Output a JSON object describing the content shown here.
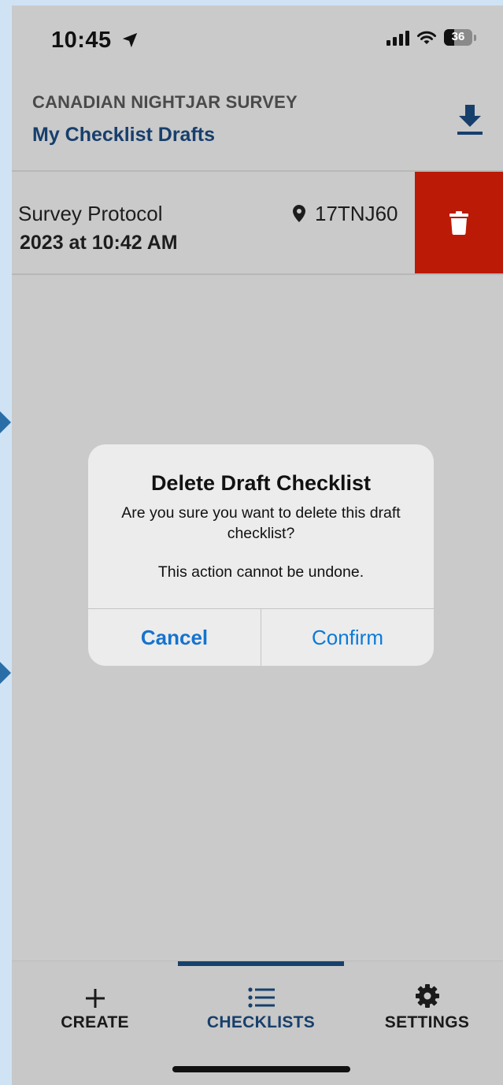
{
  "status_bar": {
    "time": "10:45",
    "battery": "36",
    "battery_level": 0.36
  },
  "header": {
    "app_title": "CANADIAN NIGHTJAR SURVEY",
    "page_title": "My Checklist Drafts"
  },
  "draft": {
    "protocol": "Survey Protocol",
    "date": "2023 at 10:42 AM",
    "location": "17TNJ60"
  },
  "dialog": {
    "title": "Delete Draft Checklist",
    "message": "Are you sure you want to delete this draft checklist?",
    "note": "This action cannot be undone.",
    "cancel_label": "Cancel",
    "confirm_label": "Confirm"
  },
  "tabs": [
    {
      "label": "CREATE",
      "icon": "plus-icon"
    },
    {
      "label": "CHECKLISTS",
      "icon": "list-icon",
      "active": true
    },
    {
      "label": "SETTINGS",
      "icon": "gear-icon"
    }
  ],
  "colors": {
    "accent": "#173f6c",
    "danger": "#bb1a06",
    "link": "#0b7ad9"
  }
}
